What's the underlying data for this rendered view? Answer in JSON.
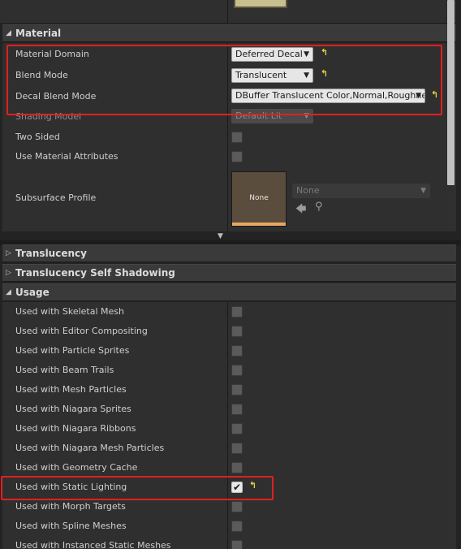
{
  "sections": {
    "material": {
      "title": "Material",
      "rows": {
        "material_domain": {
          "label": "Material Domain",
          "value": "Deferred Decal"
        },
        "blend_mode": {
          "label": "Blend Mode",
          "value": "Translucent"
        },
        "decal_blend_mode": {
          "label": "Decal Blend Mode",
          "value": "DBuffer Translucent Color,Normal,Roughness"
        },
        "shading_model": {
          "label": "Shading Model",
          "value": "Default Lit"
        },
        "two_sided": {
          "label": "Two Sided",
          "checked": false
        },
        "use_material_attributes": {
          "label": "Use Material Attributes",
          "checked": false
        },
        "subsurface_profile": {
          "label": "Subsurface Profile",
          "thumbnail": "None",
          "value": "None"
        }
      }
    },
    "translucency": {
      "title": "Translucency"
    },
    "translucency_self_shadowing": {
      "title": "Translucency Self Shadowing"
    },
    "usage": {
      "title": "Usage",
      "rows": [
        {
          "label": "Used with Skeletal Mesh",
          "checked": false
        },
        {
          "label": "Used with Editor Compositing",
          "checked": false
        },
        {
          "label": "Used with Particle Sprites",
          "checked": false
        },
        {
          "label": "Used with Beam Trails",
          "checked": false
        },
        {
          "label": "Used with Mesh Particles",
          "checked": false
        },
        {
          "label": "Used with Niagara Sprites",
          "checked": false
        },
        {
          "label": "Used with Niagara Ribbons",
          "checked": false
        },
        {
          "label": "Used with Niagara Mesh Particles",
          "checked": false
        },
        {
          "label": "Used with Geometry Cache",
          "checked": false
        },
        {
          "label": "Used with Static Lighting",
          "checked": true
        },
        {
          "label": "Used with Morph Targets",
          "checked": false
        },
        {
          "label": "Used with Spline Meshes",
          "checked": false
        },
        {
          "label": "Used with Instanced Static Meshes",
          "checked": false
        }
      ]
    }
  },
  "icons": {
    "expand": "triangle-down",
    "reset": "reset-to-default-arrow",
    "use_asset": "left-arrow",
    "browse": "magnifier"
  },
  "colors": {
    "highlight": "#e02020",
    "reset_icon": "#e6d23b"
  }
}
